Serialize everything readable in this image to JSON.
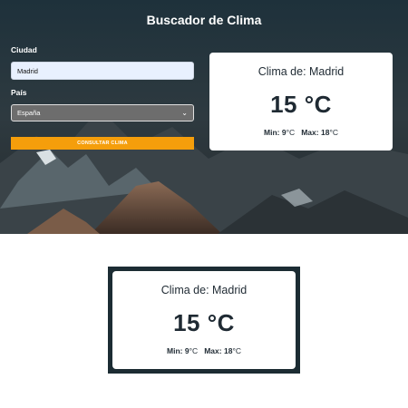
{
  "app": {
    "title": "Buscador de Clima",
    "form": {
      "city_label": "Ciudad",
      "city_value": "Madrid",
      "country_label": "País",
      "country_selected": "España",
      "submit_label": "CONSULTAR CLIMA"
    },
    "result": {
      "heading": "Clima de: Madrid",
      "temperature": "15 °C",
      "min_label": "Min:",
      "min_value": "9",
      "max_label": "Max:",
      "max_value": "18",
      "unit": "°C"
    }
  },
  "crop": {
    "heading": "Clima de: Madrid",
    "temperature": "15 °C",
    "min_label": "Min:",
    "min_value": "9",
    "max_label": "Max:",
    "max_value": "18",
    "unit": "°C"
  },
  "colors": {
    "button": "#f59e0b",
    "input_bg": "#e8f0fe",
    "select_bg": "#6d6d6d",
    "background_dark": "#1c2c33"
  },
  "icons": {
    "select_chevron": "chevron-down-icon",
    "background": "mountain-background-image"
  }
}
